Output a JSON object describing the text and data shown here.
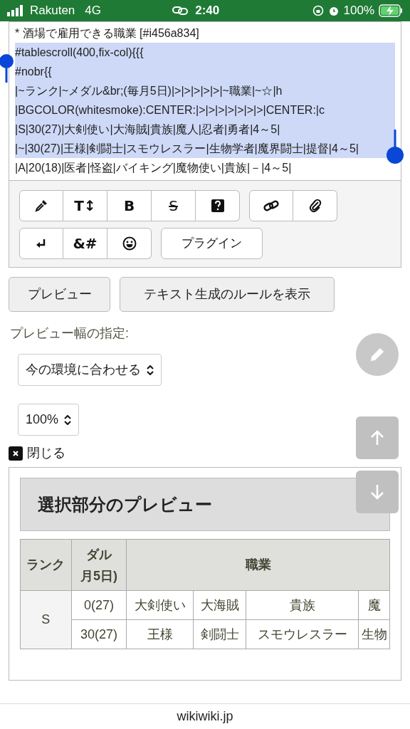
{
  "status_bar": {
    "carrier": "Rakuten",
    "network": "4G",
    "time": "2:40",
    "battery": "100%"
  },
  "editor": {
    "lines": [
      {
        "text": "* 酒場で雇用できる職業 [#i456a834]",
        "selected": false
      },
      {
        "text": "#tablescroll(400,fix-col){{{",
        "selected": true
      },
      {
        "text": "#nobr{{",
        "selected": true
      },
      {
        "text": "|~ランク|~メダル&br;(毎月5日)|>|>|>|>|>|~職業|~☆|h",
        "selected": true
      },
      {
        "text": "|BGCOLOR(whitesmoke):CENTER:|>|>|>|>|>|>|>|CENTER:|c",
        "selected": true
      },
      {
        "text": "|S|30(27)|大剣使い|大海賊|貴族|魔人|忍者|勇者|4～5|",
        "selected": true
      },
      {
        "text": "|~|30(27)|王様|剣闘士|スモウレスラー|生物学者|魔界闘士|提督|4～5|",
        "selected": true
      },
      {
        "text": "|A|20(18)|医者|怪盗|バイキング|魔物使い|貴族|－|4～5|",
        "selected": false
      }
    ]
  },
  "toolbar_rows": [
    {
      "groups": [
        {
          "buttons": [
            {
              "kind": "icon"
            },
            {
              "kind": "text",
              "label": "T↕"
            },
            {
              "kind": "text",
              "label": "B"
            },
            {
              "kind": "strike",
              "label": "S"
            },
            {
              "kind": "icon"
            }
          ]
        },
        {
          "buttons": [
            {
              "kind": "icon"
            },
            {
              "kind": "icon"
            }
          ]
        }
      ]
    },
    {
      "groups": [
        {
          "buttons": [
            {
              "kind": "icon"
            },
            {
              "kind": "text",
              "label": "&#"
            },
            {
              "kind": "icon"
            }
          ]
        },
        {
          "buttons": [
            {
              "kind": "wide",
              "label": "プラグイン"
            }
          ]
        }
      ]
    }
  ],
  "actions": [
    "プレビュー",
    "テキスト生成のルールを表示"
  ],
  "width_label": "プレビュー幅の指定:",
  "selects": [
    "今の環境に合わせる",
    "100%"
  ],
  "close_label": "閉じる",
  "preview": {
    "title": "選択部分のプレビュー",
    "table": {
      "header": [
        "ランク",
        [
          "ダル",
          "月5日)"
        ],
        "職業"
      ],
      "rows": [
        {
          "rank": "S",
          "medal": "0(27)",
          "jobs": [
            "大剣使い",
            "大海賊",
            "貴族",
            "魔"
          ]
        },
        {
          "medal": "30(27)",
          "jobs": [
            "王様",
            "剣闘士",
            "スモウレスラー",
            "生物"
          ]
        }
      ]
    }
  },
  "footer": "wikiwiki.jp"
}
